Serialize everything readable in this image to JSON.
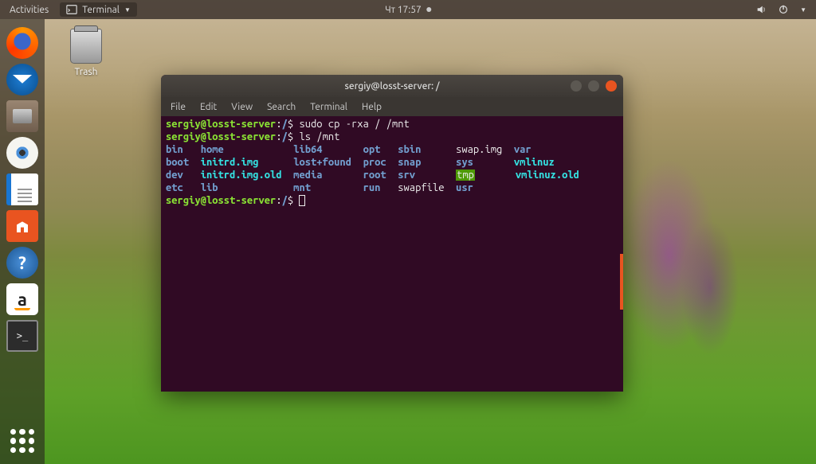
{
  "topbar": {
    "activities": "Activities",
    "app_indicator": "Terminal",
    "clock": "Чт 17:57"
  },
  "desktop": {
    "trash_label": "Trash"
  },
  "dock": {
    "items": [
      "firefox",
      "thunderbird",
      "files",
      "rhythmbox",
      "writer",
      "software",
      "help",
      "amazon",
      "terminal"
    ]
  },
  "terminal": {
    "title": "sergiy@losst-server: /",
    "menu": {
      "file": "File",
      "edit": "Edit",
      "view": "View",
      "search": "Search",
      "terminal": "Terminal",
      "help": "Help"
    },
    "prompt": {
      "user": "sergiy@losst-server",
      "path": "/",
      "symbol": "$"
    },
    "lines": [
      {
        "cmd": "sudo cp -rxa / /mnt"
      },
      {
        "cmd": "ls /mnt"
      }
    ],
    "ls": {
      "row1": {
        "c1": "bin",
        "c2": "home",
        "c3": "lib64",
        "c4": "opt",
        "c5": "sbin",
        "c6": "swap.img",
        "c7": "var"
      },
      "row2": {
        "c1": "boot",
        "c2": "initrd.img",
        "c3": "lost+found",
        "c4": "proc",
        "c5": "snap",
        "c6": "sys",
        "c7": "vmlinuz"
      },
      "row3": {
        "c1": "dev",
        "c2": "initrd.img.old",
        "c3": "media",
        "c4": "root",
        "c5": "srv",
        "c6": "tmp",
        "c7": "vmlinuz.old"
      },
      "row4": {
        "c1": "etc",
        "c2": "lib",
        "c3": "mnt",
        "c4": "run",
        "c5": "swapfile",
        "c6": "usr",
        "c7": ""
      }
    }
  }
}
